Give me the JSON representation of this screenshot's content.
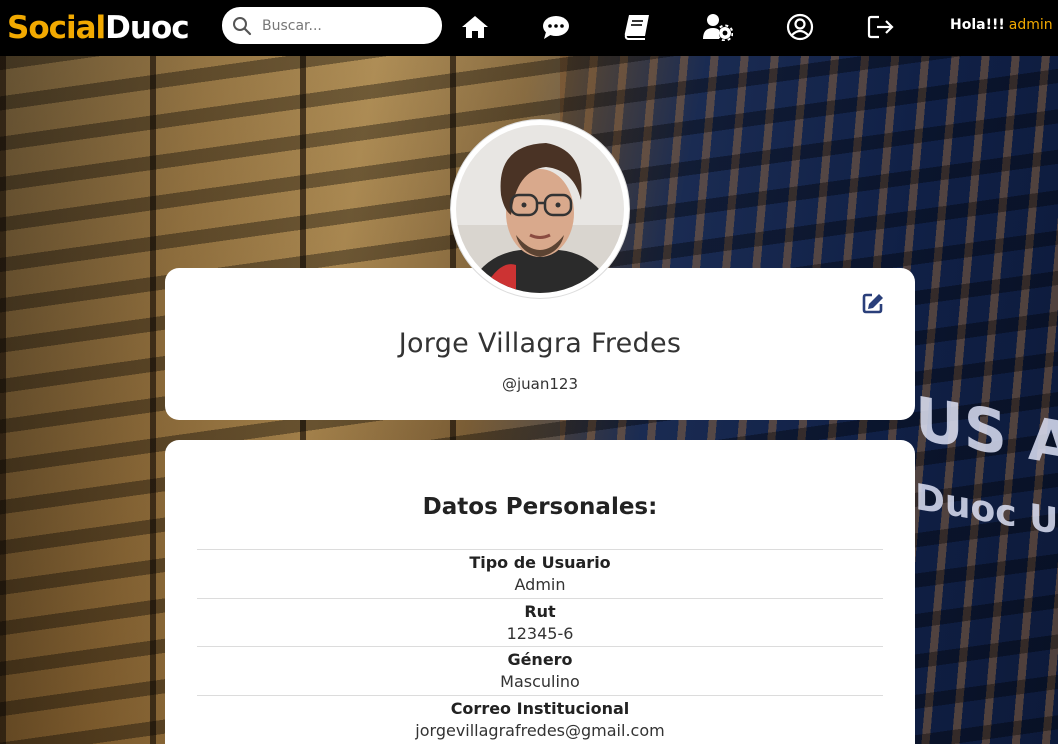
{
  "navbar": {
    "brand_part1": "Social",
    "brand_part2": "Duoc",
    "search_placeholder": "Buscar...",
    "icons": [
      "home-icon",
      "chat-icon",
      "book-icon",
      "user-settings-icon",
      "profile-icon",
      "logout-icon"
    ],
    "greeting": "Hola!!!",
    "username": "admin",
    "colors": {
      "accent": "#f2a900",
      "background": "#000000"
    }
  },
  "background": {
    "sign_text": "US ARA",
    "sign_text2": "Duoc UC"
  },
  "profile": {
    "name": "Jorge Villagra Fredes",
    "handle": "@juan123"
  },
  "details": {
    "title": "Datos Personales:",
    "rows": [
      {
        "label": "Tipo de Usuario",
        "value": "Admin"
      },
      {
        "label": "Rut",
        "value": "12345-6"
      },
      {
        "label": "Género",
        "value": "Masculino"
      },
      {
        "label": "Correo Institucional",
        "value": "jorgevillagrafredes@gmail.com"
      }
    ]
  }
}
